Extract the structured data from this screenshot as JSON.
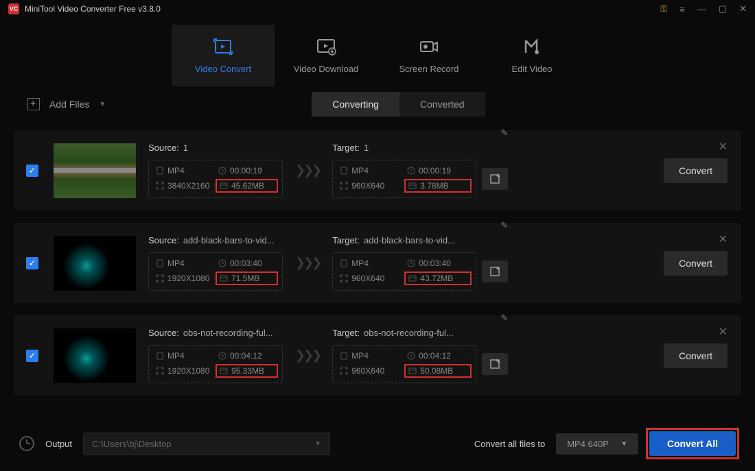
{
  "titlebar": {
    "title": "MiniTool Video Converter Free v3.8.0"
  },
  "tabs": [
    {
      "label": "Video Convert",
      "active": true
    },
    {
      "label": "Video Download",
      "active": false
    },
    {
      "label": "Screen Record",
      "active": false
    },
    {
      "label": "Edit Video",
      "active": false
    }
  ],
  "addfiles_label": "Add Files",
  "subtabs": {
    "converting": "Converting",
    "converted": "Converted"
  },
  "items": [
    {
      "checked": true,
      "thumb": "road",
      "source": {
        "title": "Source:",
        "name": "1",
        "format": "MP4",
        "duration": "00:00:19",
        "resolution": "3840X2160",
        "size": "45.62MB"
      },
      "target": {
        "title": "Target:",
        "name": "1",
        "format": "MP4",
        "duration": "00:00:19",
        "resolution": "960X640",
        "size": "3.78MB"
      },
      "convert": "Convert"
    },
    {
      "checked": true,
      "thumb": "dark",
      "source": {
        "title": "Source:",
        "name": "add-black-bars-to-vid...",
        "format": "MP4",
        "duration": "00:03:40",
        "resolution": "1920X1080",
        "size": "71.5MB"
      },
      "target": {
        "title": "Target:",
        "name": "add-black-bars-to-vid...",
        "format": "MP4",
        "duration": "00:03:40",
        "resolution": "960X640",
        "size": "43.72MB"
      },
      "convert": "Convert"
    },
    {
      "checked": true,
      "thumb": "dark",
      "source": {
        "title": "Source:",
        "name": "obs-not-recording-ful...",
        "format": "MP4",
        "duration": "00:04:12",
        "resolution": "1920X1080",
        "size": "95.33MB"
      },
      "target": {
        "title": "Target:",
        "name": "obs-not-recording-ful...",
        "format": "MP4",
        "duration": "00:04:12",
        "resolution": "960X640",
        "size": "50.08MB"
      },
      "convert": "Convert"
    }
  ],
  "footer": {
    "output_label": "Output",
    "output_path": "C:\\Users\\bj\\Desktop",
    "convert_all_label": "Convert all files to",
    "format": "MP4 640P",
    "convert_all": "Convert All"
  }
}
